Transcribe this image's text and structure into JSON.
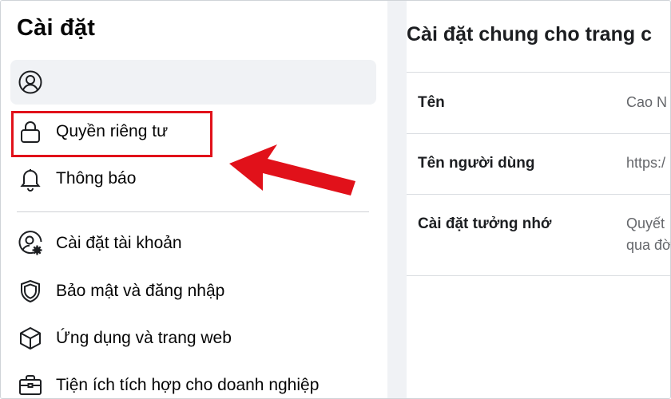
{
  "sidebar": {
    "title": "Cài đặt",
    "items": [
      {
        "label": "",
        "icon": "user-circle-icon",
        "active": true
      },
      {
        "label": "Quyền riêng tư",
        "icon": "lock-icon"
      },
      {
        "label": "Thông báo",
        "icon": "bell-icon"
      },
      {
        "label": "Cài đặt tài khoản",
        "icon": "user-gear-icon"
      },
      {
        "label": "Bảo mật và đăng nhập",
        "icon": "shield-icon"
      },
      {
        "label": "Ứng dụng và trang web",
        "icon": "cube-icon"
      },
      {
        "label": "Tiện ích tích hợp cho doanh nghiệp",
        "icon": "briefcase-icon"
      }
    ]
  },
  "main": {
    "title": "Cài đặt chung cho trang c",
    "rows": [
      {
        "label": "Tên",
        "value": "Cao N"
      },
      {
        "label": "Tên người dùng",
        "value": "https:/"
      },
      {
        "label": "Cài đặt tưởng nhớ",
        "value_line1": "Quyết",
        "value_line2": "qua đờ"
      }
    ]
  },
  "annotation": {
    "highlight_color": "#e1111a",
    "arrow_color": "#e1111a"
  }
}
